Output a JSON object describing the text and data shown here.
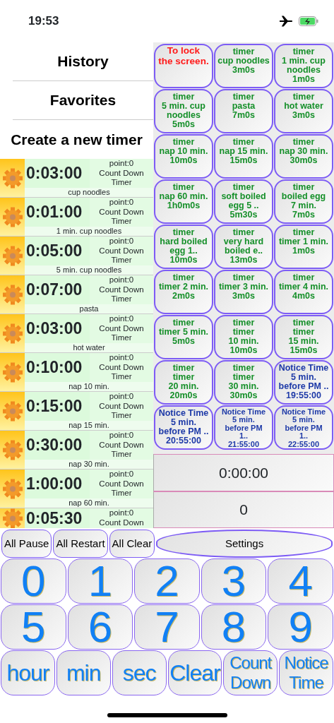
{
  "status_bar": {
    "time": "19:53"
  },
  "menu": [
    {
      "label": "History"
    },
    {
      "label": "Favorites"
    },
    {
      "label": "Create a new timer"
    }
  ],
  "timers": [
    {
      "time": "0:03:00",
      "info": [
        "point:0",
        "Count Down",
        "Timer"
      ],
      "name": "cup noodles"
    },
    {
      "time": "0:01:00",
      "info": [
        "point:0",
        "Count Down",
        "Timer"
      ],
      "name": "1 min. cup noodles"
    },
    {
      "time": "0:05:00",
      "info": [
        "point:0",
        "Count Down",
        "Timer"
      ],
      "name": "5 min. cup noodles"
    },
    {
      "time": "0:07:00",
      "info": [
        "point:0",
        "Count Down",
        "Timer"
      ],
      "name": "pasta"
    },
    {
      "time": "0:03:00",
      "info": [
        "point:0",
        "Count Down",
        "Timer"
      ],
      "name": "hot water"
    },
    {
      "time": "0:10:00",
      "info": [
        "point:0",
        "Count Down",
        "Timer"
      ],
      "name": "nap 10 min."
    },
    {
      "time": "0:15:00",
      "info": [
        "point:0",
        "Count Down",
        "Timer"
      ],
      "name": "nap 15 min."
    },
    {
      "time": "0:30:00",
      "info": [
        "point:0",
        "Count Down",
        "Timer"
      ],
      "name": "nap 30 min."
    },
    {
      "time": "1:00:00",
      "info": [
        "point:0",
        "Count Down",
        "Timer"
      ],
      "name": "nap 60 min."
    },
    {
      "time": "0:05:30",
      "info": [
        "point:0",
        "Count Down"
      ]
    }
  ],
  "presets": [
    {
      "kind": "lock",
      "lines": [
        "To lock",
        "the screen."
      ]
    },
    {
      "kind": "timer",
      "lines": [
        "timer",
        "cup noodles",
        "3m0s"
      ]
    },
    {
      "kind": "timer",
      "lines": [
        "timer",
        "1 min. cup",
        "noodles",
        "1m0s"
      ]
    },
    {
      "kind": "timer",
      "lines": [
        "timer",
        "5 min. cup",
        "noodles",
        "5m0s"
      ]
    },
    {
      "kind": "timer",
      "lines": [
        "timer",
        "pasta",
        "7m0s"
      ]
    },
    {
      "kind": "timer",
      "lines": [
        "timer",
        "hot water",
        "3m0s"
      ]
    },
    {
      "kind": "timer",
      "lines": [
        "timer",
        "nap 10 min.",
        "10m0s"
      ]
    },
    {
      "kind": "timer",
      "lines": [
        "timer",
        "nap 15 min.",
        "15m0s"
      ]
    },
    {
      "kind": "timer",
      "lines": [
        "timer",
        "nap 30 min.",
        "30m0s"
      ]
    },
    {
      "kind": "timer",
      "lines": [
        "timer",
        "nap 60 min.",
        "1h0m0s"
      ]
    },
    {
      "kind": "timer",
      "lines": [
        "timer",
        "soft boiled",
        "egg 5 ..",
        "5m30s"
      ]
    },
    {
      "kind": "timer",
      "lines": [
        "timer",
        "boiled egg",
        "7 min.",
        "7m0s"
      ]
    },
    {
      "kind": "timer",
      "lines": [
        "timer",
        "hard boiled",
        "egg 1..",
        "10m0s"
      ]
    },
    {
      "kind": "timer",
      "lines": [
        "timer",
        "very hard",
        "boiled e..",
        "13m0s"
      ]
    },
    {
      "kind": "timer",
      "lines": [
        "timer",
        "timer 1 min.",
        "1m0s"
      ]
    },
    {
      "kind": "timer",
      "lines": [
        "timer",
        "timer 2 min.",
        "2m0s"
      ]
    },
    {
      "kind": "timer",
      "lines": [
        "timer",
        "timer 3 min.",
        "3m0s"
      ]
    },
    {
      "kind": "timer",
      "lines": [
        "timer",
        "timer 4 min.",
        "4m0s"
      ]
    },
    {
      "kind": "timer",
      "lines": [
        "timer",
        "timer 5 min.",
        "5m0s"
      ]
    },
    {
      "kind": "timer",
      "lines": [
        "timer",
        "timer",
        "10 min.",
        "10m0s"
      ]
    },
    {
      "kind": "timer",
      "lines": [
        "timer",
        "timer",
        "15 min.",
        "15m0s"
      ]
    },
    {
      "kind": "timer",
      "lines": [
        "timer",
        "timer",
        "20 min.",
        "20m0s"
      ]
    },
    {
      "kind": "timer",
      "lines": [
        "timer",
        "timer",
        "30 min.",
        "30m0s"
      ]
    },
    {
      "kind": "notice",
      "lines": [
        "Notice Time",
        "5 min.",
        "before PM ..",
        "19:55:00"
      ]
    },
    {
      "kind": "notice",
      "lines": [
        "Notice Time",
        "5 min.",
        "before PM ..",
        "20:55:00"
      ]
    },
    {
      "kind": "notice",
      "lines": [
        "Notice Time",
        "5 min.",
        "before PM",
        "1..",
        "21:55:00"
      ]
    },
    {
      "kind": "notice",
      "lines": [
        "Notice Time",
        "5 min.",
        "before PM",
        "1..",
        "22:55:00"
      ]
    }
  ],
  "display": {
    "time": "0:00:00",
    "count": "0"
  },
  "actions": [
    {
      "label": "All Pause",
      "kind": "small"
    },
    {
      "label": "All Restart",
      "kind": "small"
    },
    {
      "label": "All Clear",
      "kind": "small"
    },
    {
      "label": "Settings",
      "kind": "wide"
    }
  ],
  "keypad": [
    {
      "kind": "digit",
      "lines": [
        "0"
      ]
    },
    {
      "kind": "digit",
      "lines": [
        "1"
      ]
    },
    {
      "kind": "digit",
      "lines": [
        "2"
      ]
    },
    {
      "kind": "digit",
      "lines": [
        "3"
      ]
    },
    {
      "kind": "digit",
      "lines": [
        "4"
      ]
    },
    {
      "kind": "digit",
      "lines": [
        "5"
      ]
    },
    {
      "kind": "digit",
      "lines": [
        "6"
      ]
    },
    {
      "kind": "digit",
      "lines": [
        "7"
      ]
    },
    {
      "kind": "digit",
      "lines": [
        "8"
      ]
    },
    {
      "kind": "digit",
      "lines": [
        "9"
      ]
    },
    {
      "kind": "word",
      "lines": [
        "hour"
      ]
    },
    {
      "kind": "word",
      "lines": [
        "min"
      ]
    },
    {
      "kind": "word",
      "lines": [
        "sec"
      ]
    },
    {
      "kind": "word",
      "lines": [
        "Clear"
      ]
    },
    {
      "kind": "word",
      "lines": [
        "Count",
        "Down"
      ]
    },
    {
      "kind": "word",
      "lines": [
        "Notice",
        "Time"
      ]
    }
  ]
}
